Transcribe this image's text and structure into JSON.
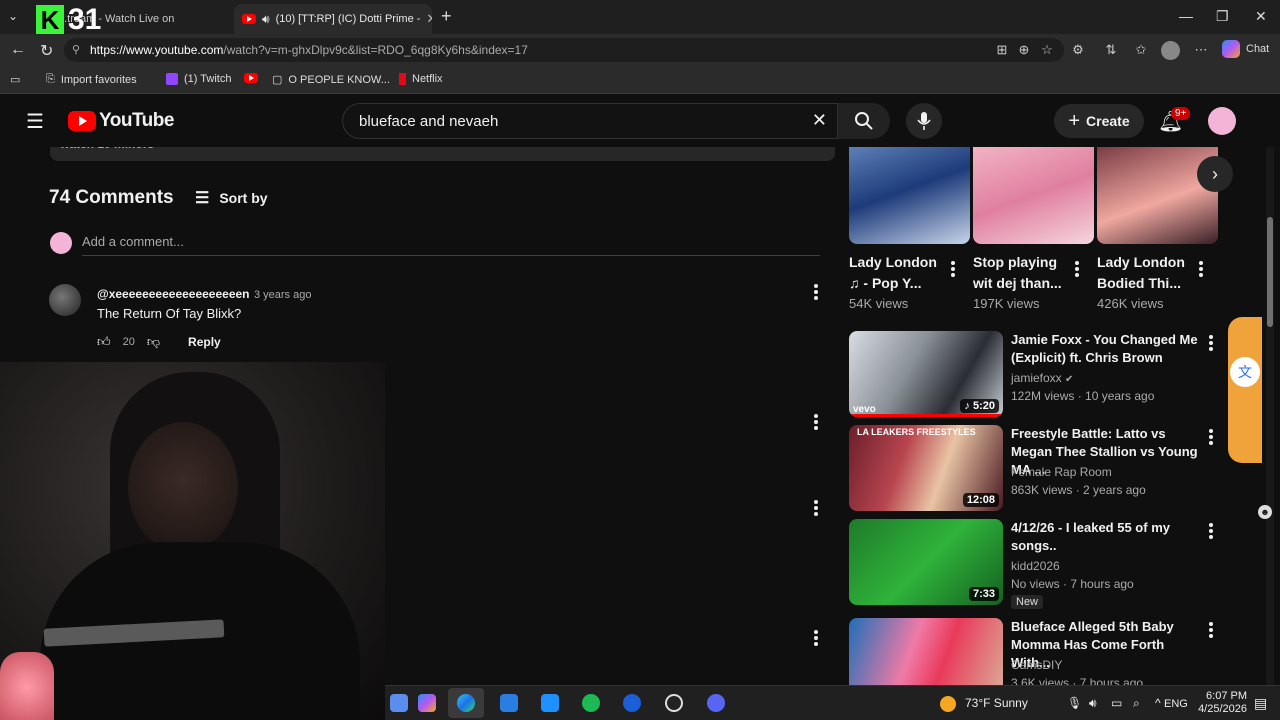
{
  "browser": {
    "tabs": [
      {
        "label": "...tream - Watch Live on"
      },
      {
        "label": "(10) [TT:RP] (IC) Dotti Prime -"
      }
    ],
    "url_host": "https://www.youtube.com",
    "url_path": "/watch?v=m-ghxDlpv9c&list=RDO_6qg8Ky6hs&index=17",
    "chat_label": "Chat",
    "favorites": [
      {
        "label": "Import favorites"
      },
      {
        "label": "(1) Twitch"
      },
      {
        "label": ""
      },
      {
        "label": "O PEOPLE KNOW..."
      },
      {
        "label": "Netflix"
      }
    ]
  },
  "overlay": {
    "k_label": "K",
    "number": "31"
  },
  "youtube": {
    "logo_text": "YouTube",
    "search_value": "blueface and nevaeh",
    "create_label": "Create",
    "notif_count": "9+",
    "comments": {
      "header_partial": "watch 10 minors",
      "count_label": "74 Comments",
      "sort_label": "Sort by",
      "add_placeholder": "Add a comment...",
      "items": [
        {
          "author": "@xeeeeeeeeeeeeeeeeeeen",
          "time": "3 years ago",
          "text": "The Return Of Tay Blixk?",
          "likes": "20",
          "reply_label": "Reply"
        }
      ]
    },
    "shorts": [
      {
        "title": "Lady London ♫ - Pop Y...",
        "views": "54K views"
      },
      {
        "title": "Stop playing wit dej than...",
        "views": "197K views"
      },
      {
        "title": "Lady London Bodied Thi...",
        "views": "426K views"
      }
    ],
    "videos": [
      {
        "title": "Jamie Foxx - You Changed Me (Explicit) ft. Chris Brown",
        "channel": "jamiefoxx",
        "meta": "122M views · 10 years ago",
        "duration": "5:20",
        "badge": "",
        "thumb_text": "vevo"
      },
      {
        "title": "Freestyle Battle: Latto vs Megan Thee Stallion vs Young MA ...",
        "channel": "Female Rap Room",
        "meta": "863K views · 2 years ago",
        "duration": "12:08",
        "badge": "",
        "thumb_text": "LA LEAKERS FREESTYLES"
      },
      {
        "title": "4/12/26 - I leaked 55 of my songs..",
        "channel": "kidd2026",
        "meta": "No views · 7 hours ago",
        "duration": "7:33",
        "badge": "New",
        "thumb_text": ""
      },
      {
        "title": "Blueface Alleged 5th Baby Momma Has Come Forth With...",
        "channel": "CamsDIY",
        "meta": "3.6K views · 7 hours ago",
        "duration": "",
        "badge": "",
        "thumb_text": ""
      }
    ]
  },
  "taskbar": {
    "weather": "73°F  Sunny",
    "lang": "ENG",
    "time": "6:07 PM",
    "date": "4/25/2026"
  },
  "colors": {
    "yt_red": "#ff0000",
    "bg": "#0f0f0f",
    "accent_pink": "#f4b4d8"
  }
}
